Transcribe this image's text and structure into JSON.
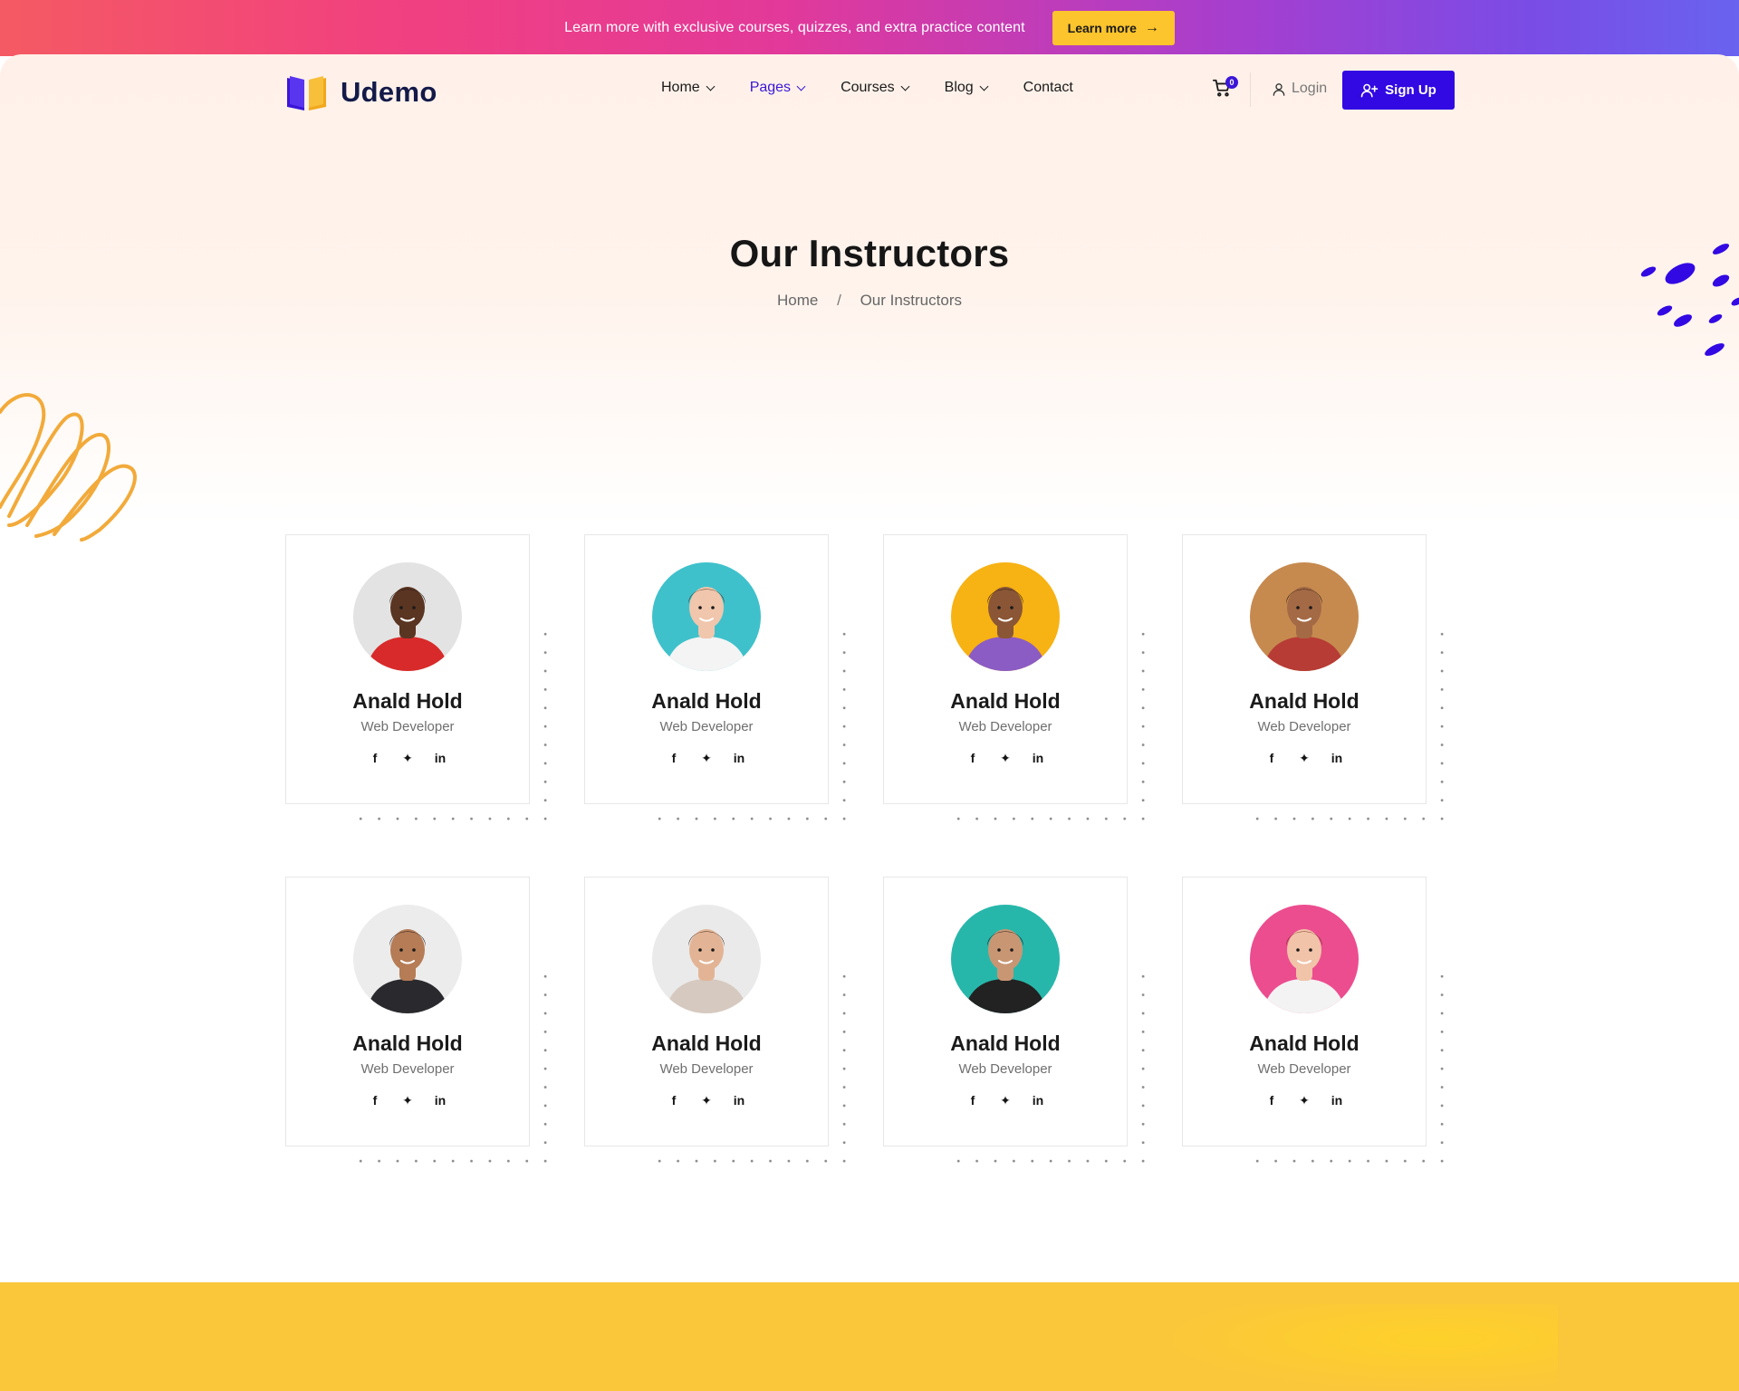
{
  "promo": {
    "text": "Learn more with exclusive courses, quizzes, and extra practice content",
    "button_label": "Learn more"
  },
  "header": {
    "brand": "Udemo",
    "nav": [
      {
        "label": "Home",
        "has_dropdown": true
      },
      {
        "label": "Pages",
        "has_dropdown": true,
        "active": true
      },
      {
        "label": "Courses",
        "has_dropdown": true
      },
      {
        "label": "Blog",
        "has_dropdown": true
      },
      {
        "label": "Contact",
        "has_dropdown": false
      }
    ],
    "cart_count": "0",
    "login_label": "Login",
    "signup_label": "Sign Up"
  },
  "hero": {
    "title": "Our Instructors",
    "breadcrumb": {
      "home": "Home",
      "separator": "/",
      "current": "Our Instructors"
    }
  },
  "instructors": [
    {
      "name": "Anald Hold",
      "role": "Web Developer",
      "avatar_bg": "#e3e3e3",
      "shirt": "#d82a2a",
      "skin": "#5a3522",
      "hair": "#1c120c"
    },
    {
      "name": "Anald Hold",
      "role": "Web Developer",
      "avatar_bg": "#3fc1cb",
      "shirt": "#f4f4f4",
      "skin": "#f0c6ac",
      "hair": "#4a2b1b"
    },
    {
      "name": "Anald Hold",
      "role": "Web Developer",
      "avatar_bg": "#f7b214",
      "shirt": "#8b5cc4",
      "skin": "#8a5636",
      "hair": "#1b110c"
    },
    {
      "name": "Anald Hold",
      "role": "Web Developer",
      "avatar_bg": "#c68a4f",
      "shirt": "#b73c35",
      "skin": "#a46a45",
      "hair": "#1f150f"
    },
    {
      "name": "Anald Hold",
      "role": "Web Developer",
      "avatar_bg": "#ececec",
      "shirt": "#2a2a2e",
      "skin": "#b57c56",
      "hair": "#161113"
    },
    {
      "name": "Anald Hold",
      "role": "Web Developer",
      "avatar_bg": "#eaeaea",
      "shirt": "#d6c9bf",
      "skin": "#e2b495",
      "hair": "#3a2418"
    },
    {
      "name": "Anald Hold",
      "role": "Web Developer",
      "avatar_bg": "#27b7aa",
      "shirt": "#222222",
      "skin": "#c99674",
      "hair": "#1a1412"
    },
    {
      "name": "Anald Hold",
      "role": "Web Developer",
      "avatar_bg": "#ec4d8f",
      "shirt": "#f3f3f3",
      "skin": "#f1c3a8",
      "hair": "#6b3020"
    }
  ],
  "social_icons": [
    "facebook-icon",
    "twitter-icon",
    "linkedin-icon"
  ],
  "social_glyphs": {
    "facebook": "f",
    "twitter": "✦",
    "linkedin": "in"
  },
  "colors": {
    "accent": "#3208e3",
    "promo_button": "#fcc42d",
    "band": "#fac73a"
  }
}
